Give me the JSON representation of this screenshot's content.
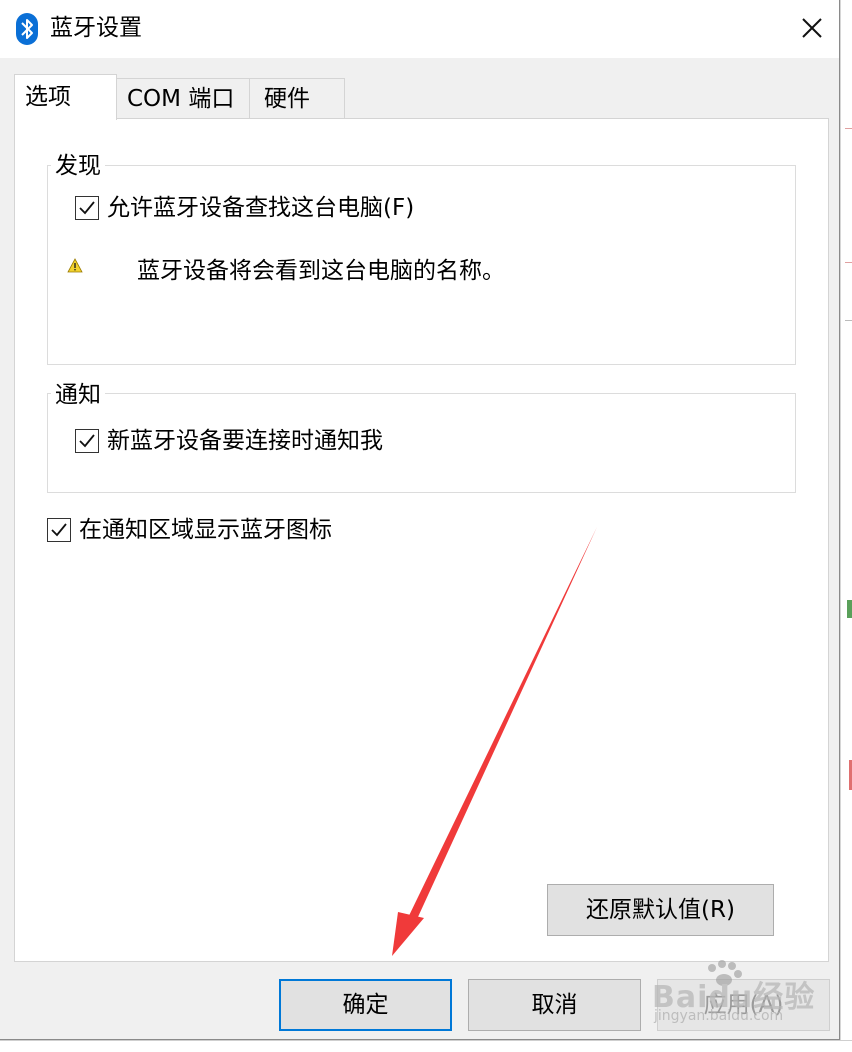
{
  "window": {
    "title": "蓝牙设置",
    "close_glyph": "✕"
  },
  "tabs": [
    {
      "label": "选项",
      "active": true
    },
    {
      "label": "COM 端口",
      "active": false
    },
    {
      "label": "硬件",
      "active": false
    }
  ],
  "discovery": {
    "title": "发现",
    "allow_find": {
      "label": "允许蓝牙设备查找这台电脑(F)",
      "checked": true
    },
    "warning": "蓝牙设备将会看到这台电脑的名称。"
  },
  "notify": {
    "title": "通知",
    "notify_new": {
      "label": "新蓝牙设备要连接时通知我",
      "checked": true
    }
  },
  "show_icon": {
    "label": "在通知区域显示蓝牙图标",
    "checked": true
  },
  "buttons": {
    "restore": "还原默认值(R)",
    "ok": "确定",
    "cancel": "取消",
    "apply": "应用(A)"
  },
  "watermark": {
    "brand": "Baidu经验",
    "url": "jingyan.baidu.com"
  },
  "colors": {
    "accent": "#0078d7",
    "annotation_arrow": "#f03a3a",
    "bluetooth": "#0a6fd6",
    "warning": "#f2d22e"
  }
}
